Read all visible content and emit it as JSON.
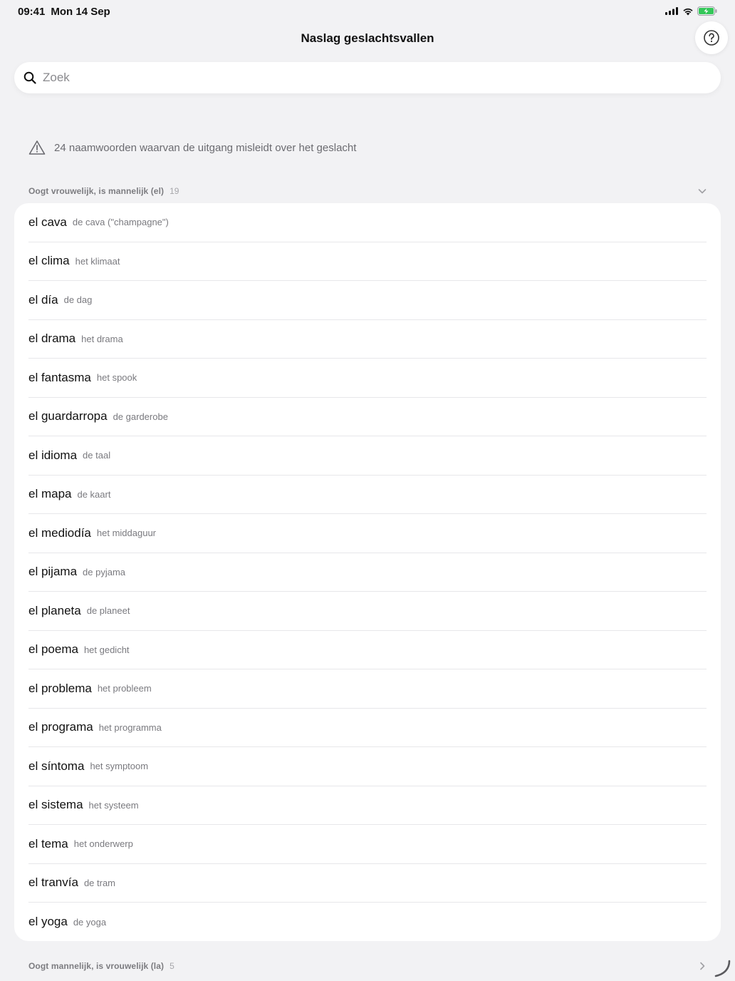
{
  "status": {
    "time": "09:41",
    "date": "Mon 14 Sep"
  },
  "title": "Naslag geslachtsvallen",
  "search": {
    "placeholder": "Zoek",
    "value": ""
  },
  "notice": "24 naamwoorden waarvan de uitgang misleidt over het geslacht",
  "sections": [
    {
      "title": "Oogt vrouwelijk, is mannelijk (el)",
      "count": "19",
      "expanded": true,
      "items": [
        {
          "word": "el cava",
          "translation": "de cava (\"champagne\")"
        },
        {
          "word": "el clima",
          "translation": "het klimaat"
        },
        {
          "word": "el día",
          "translation": "de dag"
        },
        {
          "word": "el drama",
          "translation": "het drama"
        },
        {
          "word": "el fantasma",
          "translation": "het spook"
        },
        {
          "word": "el guardarropa",
          "translation": "de garderobe"
        },
        {
          "word": "el idioma",
          "translation": "de taal"
        },
        {
          "word": "el mapa",
          "translation": "de kaart"
        },
        {
          "word": "el mediodía",
          "translation": "het middaguur"
        },
        {
          "word": "el pijama",
          "translation": "de pyjama"
        },
        {
          "word": "el planeta",
          "translation": "de planeet"
        },
        {
          "word": "el poema",
          "translation": "het gedicht"
        },
        {
          "word": "el problema",
          "translation": "het probleem"
        },
        {
          "word": "el programa",
          "translation": "het programma"
        },
        {
          "word": "el síntoma",
          "translation": "het symptoom"
        },
        {
          "word": "el sistema",
          "translation": "het systeem"
        },
        {
          "word": "el tema",
          "translation": "het onderwerp"
        },
        {
          "word": "el tranvía",
          "translation": "de tram"
        },
        {
          "word": "el yoga",
          "translation": "de yoga"
        }
      ]
    },
    {
      "title": "Oogt mannelijk, is vrouwelijk (la)",
      "count": "5",
      "expanded": false,
      "items": []
    }
  ],
  "icons": {
    "help": "question-circle-icon",
    "search": "magnifier-icon",
    "warning": "warning-triangle-icon",
    "expanded": "chevron-down-icon",
    "collapsed": "chevron-right-icon"
  },
  "colors": {
    "background": "#f2f2f4",
    "battery": "#34c759"
  }
}
